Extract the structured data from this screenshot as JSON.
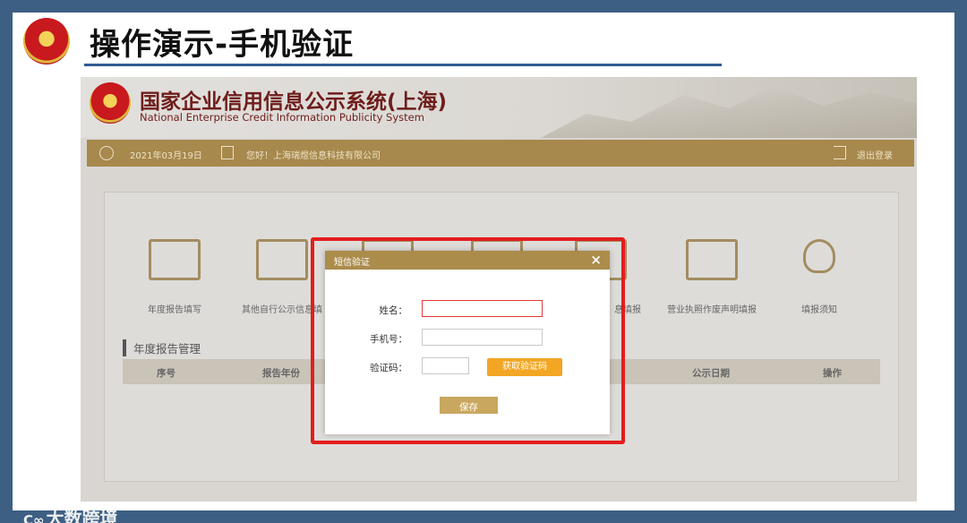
{
  "slide": {
    "title": "操作演示-手机验证"
  },
  "system": {
    "title": "国家企业信用信息公示系统(上海)",
    "subtitle": "National Enterprise Credit Information Publicity System",
    "date": "2021年03月19日",
    "greeting": "您好！上海瑞煜信息科技有限公司",
    "logout": "退出登录"
  },
  "menu": [
    {
      "label": "年度报告填写",
      "icon": "edit-report-icon"
    },
    {
      "label": "其他自行公示信息填",
      "icon": "inbox-icon"
    },
    {
      "label": "",
      "icon": "form-icon"
    },
    {
      "label": "",
      "icon": "upload-icon"
    },
    {
      "label": "息填报",
      "icon": "edit-info-icon"
    },
    {
      "label": "营业执照作废声明填报",
      "icon": "license-icon"
    },
    {
      "label": "填报须知",
      "icon": "lightbulb-icon"
    }
  ],
  "section": {
    "title": "年度报告管理",
    "columns": [
      "序号",
      "报告年份",
      "公示日期",
      "操作"
    ]
  },
  "modal": {
    "title": "短信验证",
    "close": "×",
    "name_label": "姓名：",
    "name_value": "",
    "phone_label": "手机号：",
    "phone_value": "",
    "code_label": "验证码：",
    "code_value": "",
    "get_code": "获取验证码",
    "save": "保存"
  },
  "watermark": {
    "text": "大数跨境",
    "logo": "C∞"
  },
  "colors": {
    "accent": "#ab8c4b",
    "highlight": "#e31d1d",
    "title_rule": "#2e5d93",
    "button": "#f3a624"
  }
}
